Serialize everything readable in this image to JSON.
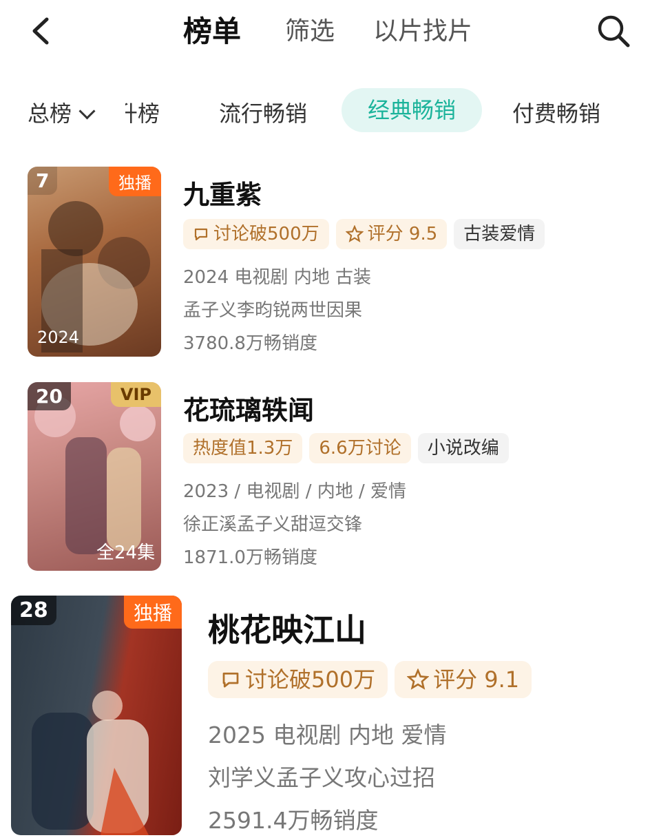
{
  "header": {
    "tabs": [
      "榜单",
      "筛选",
      "以片找片"
    ]
  },
  "categories": {
    "dropdown_label": "总榜",
    "items": [
      "升榜",
      "流行畅销",
      "经典畅销",
      "付费畅销"
    ],
    "active": "经典畅销"
  },
  "list": [
    {
      "rank": "7",
      "badge": "独播",
      "poster_year": "2024",
      "title": "九重紫",
      "tags": [
        "讨论破500万",
        "评分 9.5",
        "古装爱情"
      ],
      "meta1": "2024 电视剧 内地 古装",
      "meta2": "孟子义李昀锐两世因果",
      "meta3": "3780.8万畅销度"
    },
    {
      "rank": "20",
      "badge": "VIP",
      "poster_sub": "全24集",
      "title": "花琉璃轶闻",
      "tags": [
        "热度值1.3万",
        "6.6万讨论",
        "小说改编"
      ],
      "meta1": "2023 / 电视剧 / 内地 / 爱情",
      "meta2": "徐正溪孟子义甜逗交锋",
      "meta3": "1871.0万畅销度"
    },
    {
      "rank": "28",
      "badge": "独播",
      "title": "桃花映江山",
      "tags": [
        "讨论破500万",
        "评分 9.1"
      ],
      "meta1": "2025 电视剧 内地 爱情",
      "meta2": "刘学义孟子义攻心过招",
      "meta3": "2591.4万畅销度"
    }
  ],
  "colors": {
    "active_tab_bg": "#e3f6f3",
    "active_tab_text": "#1ab39a",
    "badge_orange": "#ff6a1a",
    "tag_bg": "#fdf3e6",
    "tag_text": "#b0702a"
  },
  "icons": [
    "back-arrow-icon",
    "search-icon",
    "chevron-down-icon",
    "comment-icon",
    "star-icon"
  ]
}
